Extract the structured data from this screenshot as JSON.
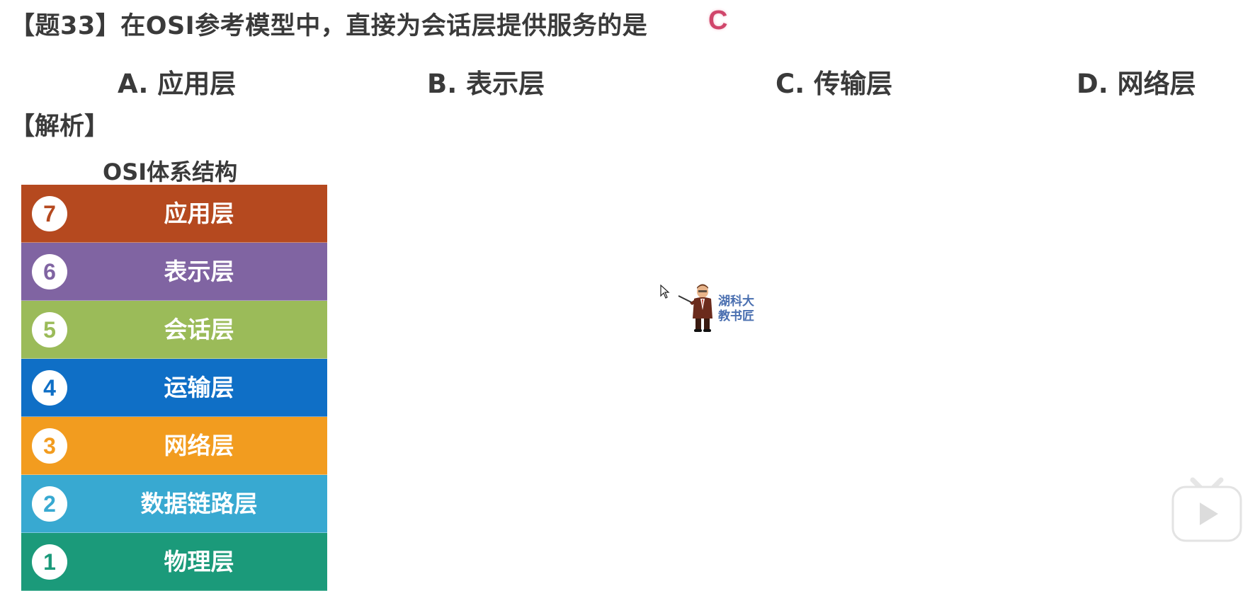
{
  "question": {
    "text": "【题33】在OSI参考模型中，直接为会话层提供服务的是",
    "answer": "C"
  },
  "options": [
    {
      "label": "A. 应用层"
    },
    {
      "label": "B. 表示层"
    },
    {
      "label": "C. 传输层"
    },
    {
      "label": "D. 网络层"
    }
  ],
  "analysis_label": "【解析】",
  "osi": {
    "title": "OSI体系结构",
    "layers": [
      {
        "num": "7",
        "name": "应用层",
        "color": "#b5491f"
      },
      {
        "num": "6",
        "name": "表示层",
        "color": "#8064a2"
      },
      {
        "num": "5",
        "name": "会话层",
        "color": "#9bbb59"
      },
      {
        "num": "4",
        "name": "运输层",
        "color": "#0f6fc6"
      },
      {
        "num": "3",
        "name": "网络层",
        "color": "#f29c1f"
      },
      {
        "num": "2",
        "name": "数据链路层",
        "color": "#38a9d1"
      },
      {
        "num": "1",
        "name": "物理层",
        "color": "#1b9a7a"
      }
    ]
  },
  "watermark": {
    "line1": "湖科大",
    "line2": "教书匠"
  },
  "icons": [
    "cursor-icon",
    "teacher-icon",
    "play-icon"
  ]
}
